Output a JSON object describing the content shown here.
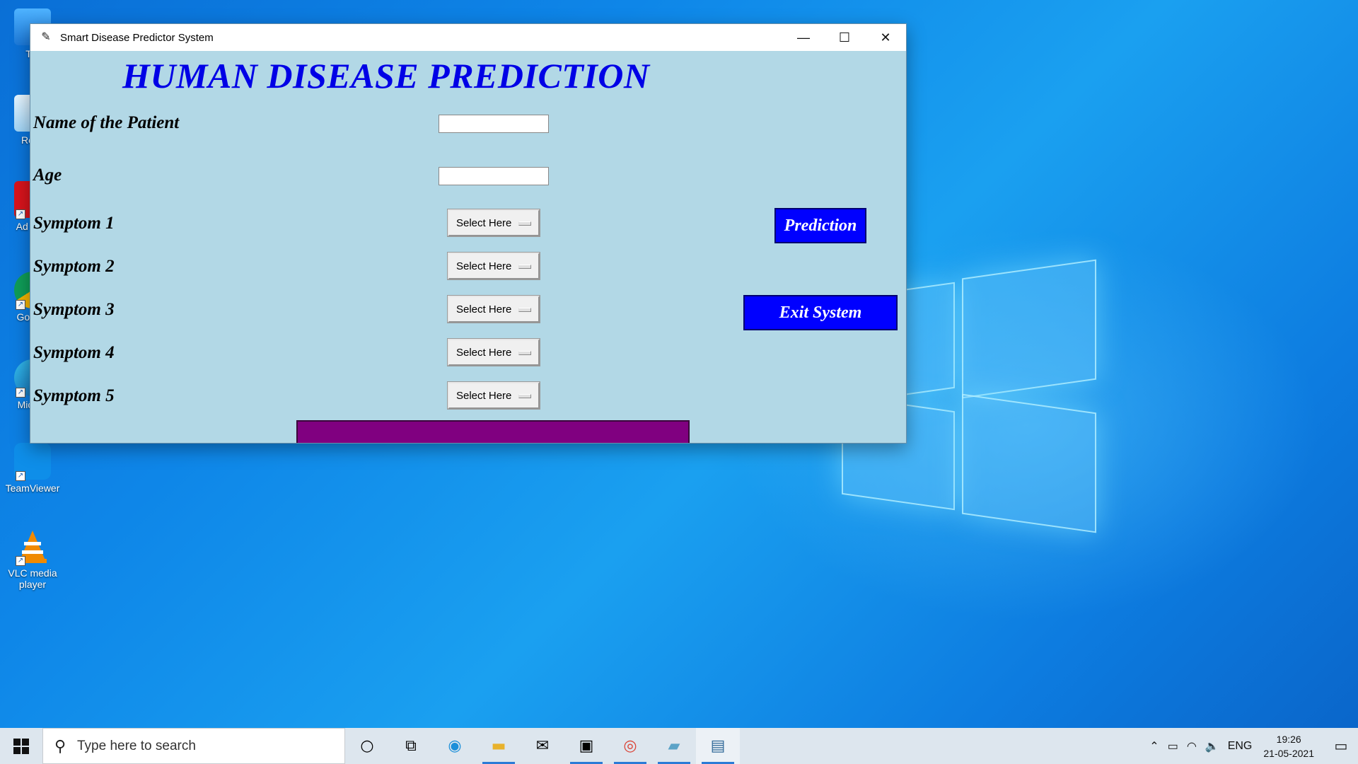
{
  "window": {
    "title": "Smart Disease Predictor System",
    "icon": "feather-icon",
    "minimize_glyph": "—",
    "maximize_glyph": "☐",
    "close_glyph": "✕"
  },
  "app": {
    "heading": "HUMAN DISEASE PREDICTION",
    "name_label": "Name of the Patient",
    "name_value": "",
    "age_label": "Age",
    "age_value": "",
    "symptoms": [
      {
        "label": "Symptom 1",
        "selected": "Select Here"
      },
      {
        "label": "Symptom 2",
        "selected": "Select Here"
      },
      {
        "label": "Symptom 3",
        "selected": "Select Here"
      },
      {
        "label": "Symptom 4",
        "selected": "Select Here"
      },
      {
        "label": "Symptom 5",
        "selected": "Select Here"
      }
    ],
    "prediction_button": "Prediction",
    "exit_button": "Exit System",
    "result_text": "",
    "colors": {
      "background": "#b2d8e6",
      "heading": "#0000e6",
      "button": "#0000ff",
      "result": "#800080"
    }
  },
  "desktop": {
    "icons": [
      {
        "label": "Thi",
        "icon": "this-pc-icon"
      },
      {
        "label": "Recy",
        "icon": "recycle-bin-icon"
      },
      {
        "label": "Ad Rea",
        "icon": "adobe-reader-icon"
      },
      {
        "label": "Go Chr",
        "icon": "google-chrome-icon"
      },
      {
        "label": "Mic Ed",
        "icon": "microsoft-edge-icon"
      },
      {
        "label": "TeamViewer",
        "icon": "teamviewer-icon"
      },
      {
        "label": "VLC media player",
        "icon": "vlc-icon"
      }
    ]
  },
  "taskbar": {
    "search_placeholder": "Type here to search",
    "apps": [
      "cortana-icon",
      "task-view-icon",
      "edge-icon",
      "file-explorer-icon",
      "mail-icon",
      "terminal-icon",
      "chrome-icon",
      "notepad-icon",
      "python-idle-icon"
    ],
    "tray": {
      "language": "ENG",
      "time": "19:26",
      "date": "21-05-2021"
    }
  }
}
